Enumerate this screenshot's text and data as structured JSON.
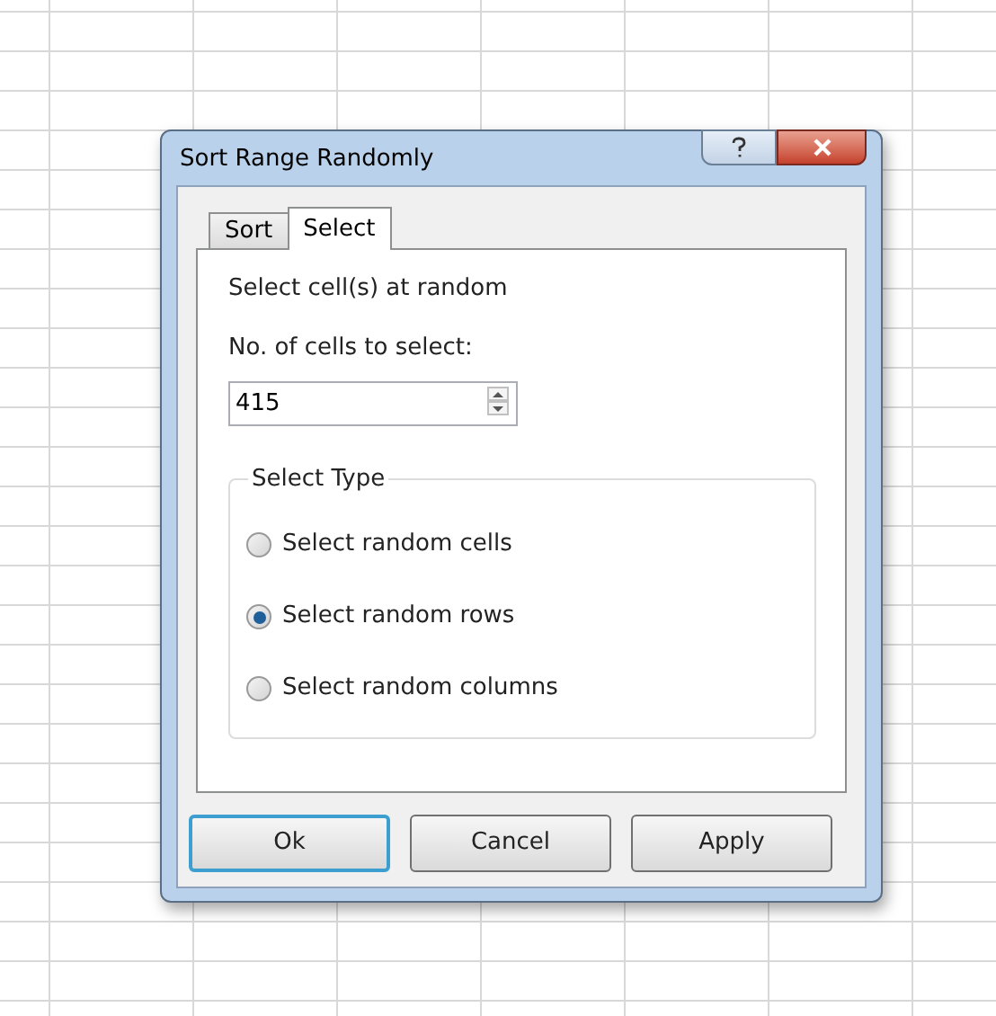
{
  "window": {
    "title": "Sort Range Randomly"
  },
  "tabs": [
    {
      "label": "Sort",
      "selected": false
    },
    {
      "label": "Select",
      "selected": true
    }
  ],
  "description": "Select cell(s) at random",
  "count_field": {
    "label": "No. of cells to select:",
    "value": "415"
  },
  "select_type": {
    "title": "Select Type",
    "options": [
      {
        "label": "Select random cells",
        "selected": false
      },
      {
        "label": "Select random rows",
        "selected": true
      },
      {
        "label": "Select random columns",
        "selected": false
      }
    ]
  },
  "buttons": [
    {
      "label": "Ok",
      "default": true
    },
    {
      "label": "Cancel",
      "default": false
    },
    {
      "label": "Apply",
      "default": false
    }
  ]
}
